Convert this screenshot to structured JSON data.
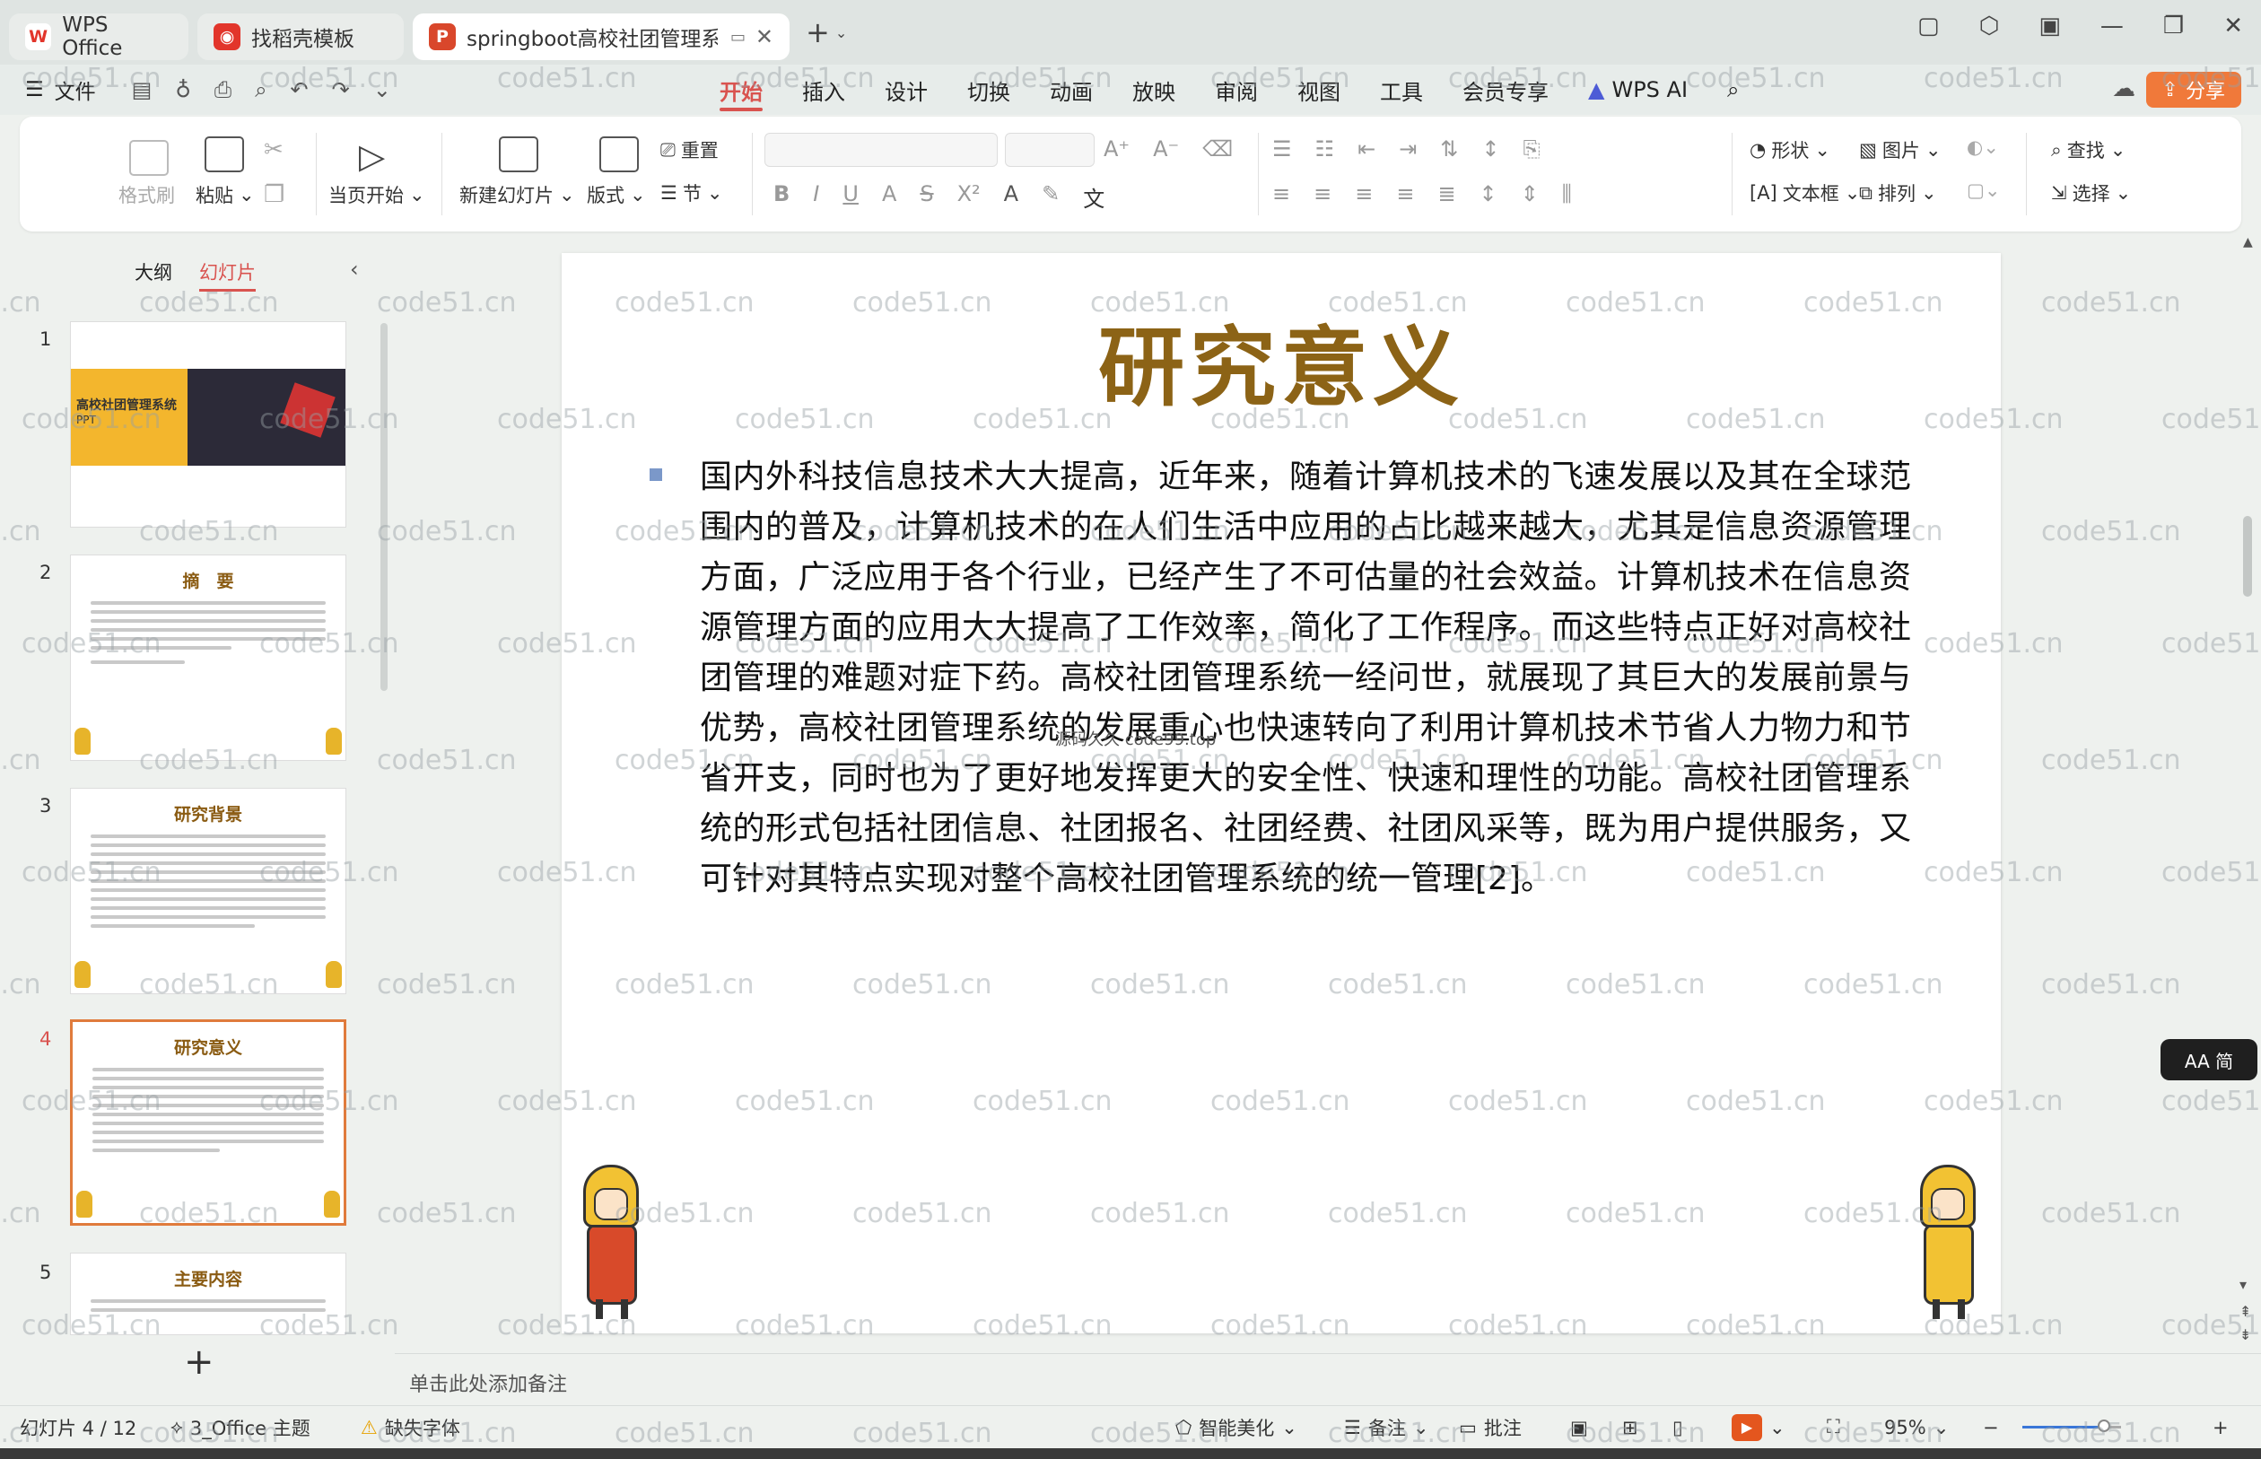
{
  "titlebar": {
    "tabs": [
      {
        "label": "WPS Office",
        "logo": "W",
        "logo_color": "#e2352b"
      },
      {
        "label": "找稻壳模板",
        "logo": "⬤",
        "logo_color": "#e2352b"
      },
      {
        "label": "springboot高校社团管理系统",
        "logo": "P",
        "logo_color": "#d9472b"
      }
    ],
    "new_tab_icon": "plus-icon"
  },
  "menubar": {
    "file_label": "文件",
    "tabs": [
      "开始",
      "插入",
      "设计",
      "切换",
      "动画",
      "放映",
      "审阅",
      "视图",
      "工具",
      "会员专享",
      "WPS AI"
    ],
    "active_tab": "开始",
    "share_label": "分享"
  },
  "ribbon": {
    "format_painter": "格式刷",
    "paste": "粘贴",
    "start_from_current": "当页开始",
    "new_slide": "新建幻灯片",
    "layout": "版式",
    "reset": "重置",
    "section": "节",
    "shape": "形状",
    "picture": "图片",
    "find": "查找",
    "textbox": "文本框",
    "arrange": "排列",
    "select": "选择"
  },
  "sidebar": {
    "tab_outline": "大纲",
    "tab_slides": "幻灯片",
    "thumbnails": [
      {
        "num": "1",
        "title": "高校社团管理系统",
        "subtitle": "PPT"
      },
      {
        "num": "2",
        "title": "摘　要"
      },
      {
        "num": "3",
        "title": "研究背景"
      },
      {
        "num": "4",
        "title": "研究意义"
      },
      {
        "num": "5",
        "title": "主要内容"
      }
    ],
    "active_index": 4
  },
  "slide": {
    "title": "研究意义",
    "body": "国内外科技信息技术大大提高，近年来，随着计算机技术的飞速发展以及其在全球范围内的普及，计算机技术的在人们生活中应用的占比越来越大，尤其是信息资源管理方面，广泛应用于各个行业，已经产生了不可估量的社会效益。计算机技术在信息资源管理方面的应用大大提高了工作效率，简化了工作程序。而这些特点正好对高校社团管理的难题对症下药。高校社团管理系统一经问世，就展现了其巨大的发展前景与优势，高校社团管理系统的发展重心也快速转向了利用计算机技术节省人力物力和节省开支，同时也为了更好地发挥更大的安全性、快速和理性的功能。高校社团管理系统的形式包括社团信息、社团报名、社团经费、社团风采等，既为用户提供服务，又可针对其特点实现对整个高校社团管理系统的统一管理[2]。",
    "inline_watermark": "源码久久 code99.top"
  },
  "notes_placeholder": "单击此处添加备注",
  "statusbar": {
    "slide_counter": "幻灯片 4 / 12",
    "theme": "3_Office 主题",
    "missing_font": "缺失字体",
    "beautify": "智能美化",
    "notes": "备注",
    "comments": "批注",
    "zoom": "95%"
  },
  "aa_label": "AA 简",
  "watermark": "code51.cn",
  "colors": {
    "accent": "#d9534f",
    "title_gold": "#8c6316",
    "share": "#f0793a",
    "active_thumb_border": "#e07b3c"
  }
}
